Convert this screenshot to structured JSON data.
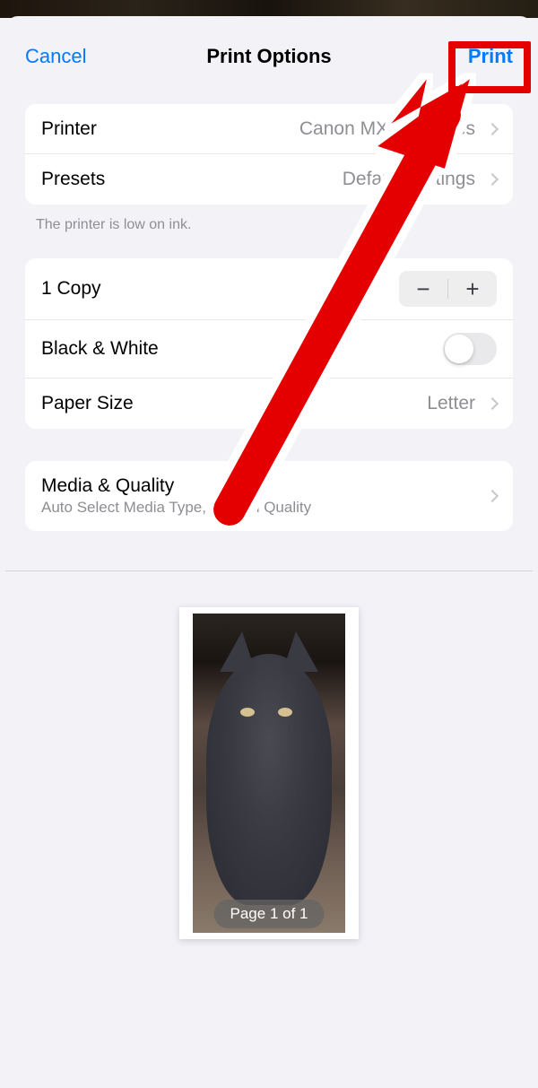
{
  "navbar": {
    "cancel": "Cancel",
    "title": "Print Options",
    "print": "Print"
  },
  "printer": {
    "label": "Printer",
    "value": "Canon MX490 series"
  },
  "presets": {
    "label": "Presets",
    "value": "Default Settings"
  },
  "footnote": "The printer is low on ink.",
  "copies": {
    "label": "1 Copy"
  },
  "bw": {
    "label": "Black & White"
  },
  "paper": {
    "label": "Paper Size",
    "value": "Letter"
  },
  "media": {
    "label": "Media & Quality",
    "sub": "Auto Select Media Type, Normal Quality"
  },
  "page_badge": "Page 1 of 1"
}
